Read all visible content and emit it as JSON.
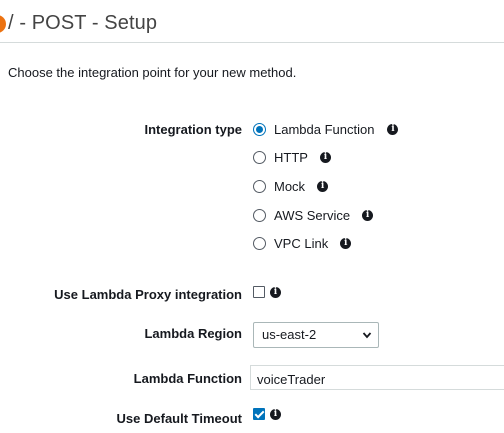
{
  "header": {
    "title": "/ - POST - Setup"
  },
  "intro": "Choose the integration point for your new method.",
  "integration_type": {
    "label": "Integration type",
    "options": [
      {
        "label": "Lambda Function",
        "selected": true
      },
      {
        "label": "HTTP",
        "selected": false
      },
      {
        "label": "Mock",
        "selected": false
      },
      {
        "label": "AWS Service",
        "selected": false
      },
      {
        "label": "VPC Link",
        "selected": false
      }
    ]
  },
  "proxy": {
    "label": "Use Lambda Proxy integration",
    "checked": false
  },
  "region": {
    "label": "Lambda Region",
    "value": "us-east-2"
  },
  "function": {
    "label": "Lambda Function",
    "value": "voiceTrader"
  },
  "timeout": {
    "label": "Use Default Timeout",
    "checked": true
  },
  "icons": {
    "info": "i"
  },
  "colors": {
    "accent": "#0073bb",
    "header_icon": "#ec7211"
  }
}
